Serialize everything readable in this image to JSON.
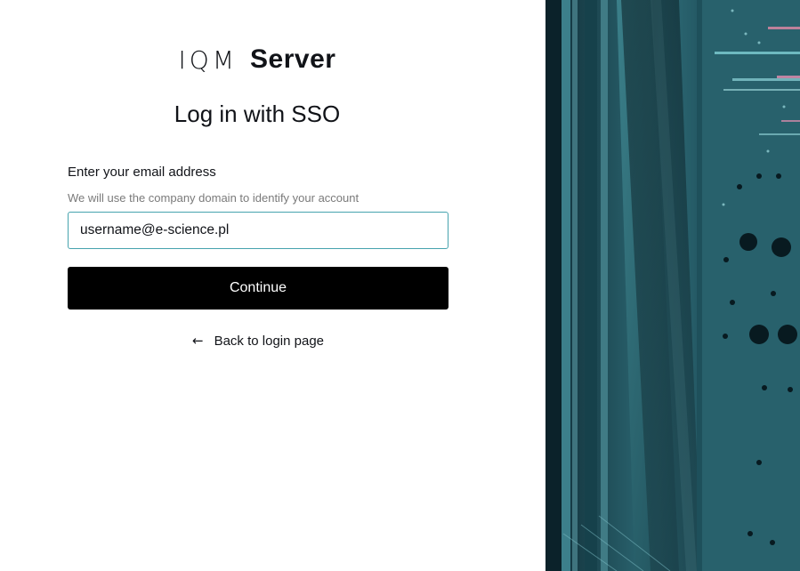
{
  "brand": {
    "mark": "IQM",
    "product": "Server"
  },
  "page_title": "Log in with SSO",
  "form": {
    "email_label": "Enter your email address",
    "email_hint": "We will use the company domain to identify your account",
    "email_value": "username@e-science.pl",
    "continue_label": "Continue"
  },
  "back_link": {
    "icon": "arrow-left-icon",
    "label": "Back to login page"
  },
  "hero_image": {
    "description_icon": "server-hardware-photo"
  },
  "colors": {
    "input_border": "#47a3ae",
    "button_bg": "#000000",
    "button_text": "#ffffff",
    "hint_text": "#7a7a7a",
    "image_tint": "#2c6b78"
  }
}
